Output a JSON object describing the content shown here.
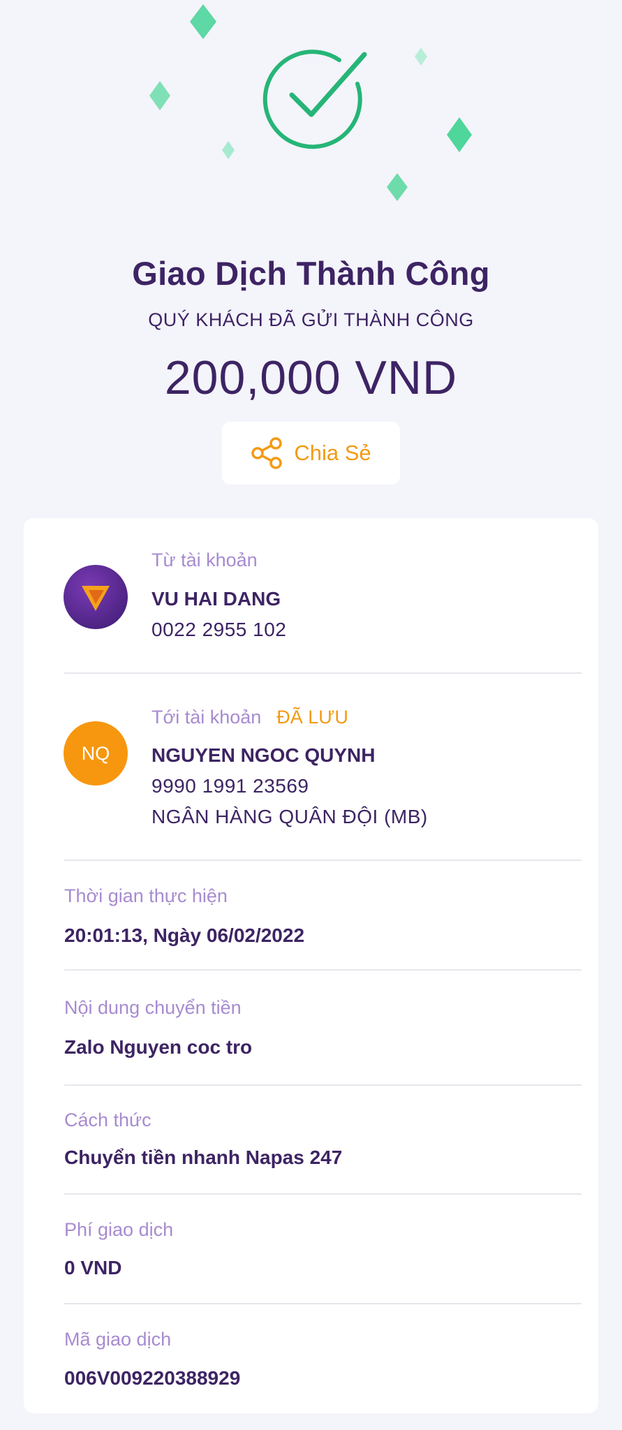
{
  "header": {
    "title": "Giao Dịch Thành Công",
    "subtitle": "QUÝ KHÁCH ĐÃ GỬI THÀNH CÔNG",
    "amount": "200,000 VND",
    "share_label": "Chia Sẻ"
  },
  "colors": {
    "primary": "#3d2463",
    "label": "#a78bd0",
    "accent": "#f39a12",
    "success": "#26b577",
    "sparkle": "#5ed8a4"
  },
  "from_account": {
    "label": "Từ tài khoản",
    "name": "VU HAI DANG",
    "number": "0022 2955 102",
    "icon": "bank-logo-icon"
  },
  "to_account": {
    "label": "Tới tài khoản",
    "saved_badge": "ĐÃ LƯU",
    "avatar_initials": "NQ",
    "name": "NGUYEN NGOC QUYNH",
    "number": "9990 1991 23569",
    "bank": "NGÂN HÀNG QUÂN ĐỘI (MB)"
  },
  "details": [
    {
      "label": "Thời gian thực hiện",
      "value": "20:01:13, Ngày 06/02/2022"
    },
    {
      "label": "Nội dung chuyển tiền",
      "value": "Zalo Nguyen coc tro"
    },
    {
      "label": "Cách thức",
      "value": "Chuyển tiền nhanh Napas 247"
    },
    {
      "label": "Phí giao dịch",
      "value": "0 VND"
    },
    {
      "label": "Mã giao dịch",
      "value": "006V009220388929"
    }
  ]
}
